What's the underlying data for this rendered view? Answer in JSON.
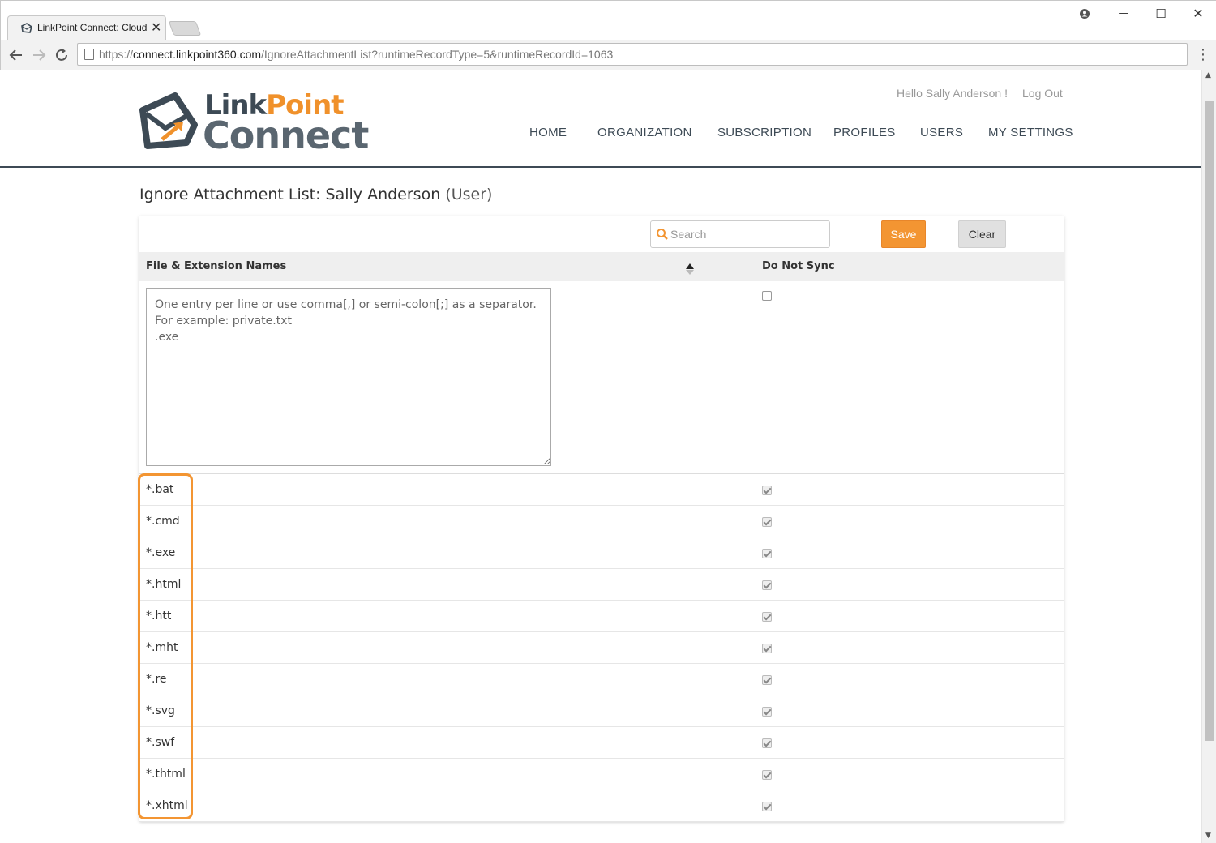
{
  "browser": {
    "tab_title": "LinkPoint Connect: Cloud",
    "url_prefix": "https://",
    "url_host": "connect.linkpoint360.com",
    "url_path": "/IgnoreAttachmentList?runtimeRecordType=5&runtimeRecordId=1063",
    "close_glyph": "✕",
    "minimize_glyph": "—",
    "maximize_glyph": "☐",
    "menu_glyph": "⋮"
  },
  "header": {
    "logo_link": "Link",
    "logo_point": "Point",
    "logo_connect": "Connect",
    "greeting": "Hello Sally Anderson !",
    "logout": "Log Out",
    "nav": [
      "HOME",
      "ORGANIZATION",
      "SUBSCRIPTION",
      "PROFILES",
      "USERS",
      "MY SETTINGS"
    ]
  },
  "page": {
    "title": "Ignore Attachment List: Sally Anderson",
    "title_suffix": "(User)"
  },
  "toolbar": {
    "search_placeholder": "Search",
    "save_label": "Save",
    "clear_label": "Clear"
  },
  "table": {
    "col_name": "File & Extension Names",
    "col_sync": "Do Not Sync",
    "entry_placeholder": "One entry per line or use comma[,] or semi-colon[;] as a separator.\nFor example: private.txt\n.exe",
    "new_entry_checked": false,
    "rows": [
      {
        "name": "*.bat",
        "do_not_sync": true
      },
      {
        "name": "*.cmd",
        "do_not_sync": true
      },
      {
        "name": "*.exe",
        "do_not_sync": true
      },
      {
        "name": "*.html",
        "do_not_sync": true
      },
      {
        "name": "*.htt",
        "do_not_sync": true
      },
      {
        "name": "*.mht",
        "do_not_sync": true
      },
      {
        "name": "*.re",
        "do_not_sync": true
      },
      {
        "name": "*.svg",
        "do_not_sync": true
      },
      {
        "name": "*.swf",
        "do_not_sync": true
      },
      {
        "name": "*.thtml",
        "do_not_sync": true
      },
      {
        "name": "*.xhtml",
        "do_not_sync": true
      }
    ]
  },
  "colors": {
    "accent": "#f39532",
    "header_border": "#3d4a55",
    "highlight": "#f39532"
  }
}
